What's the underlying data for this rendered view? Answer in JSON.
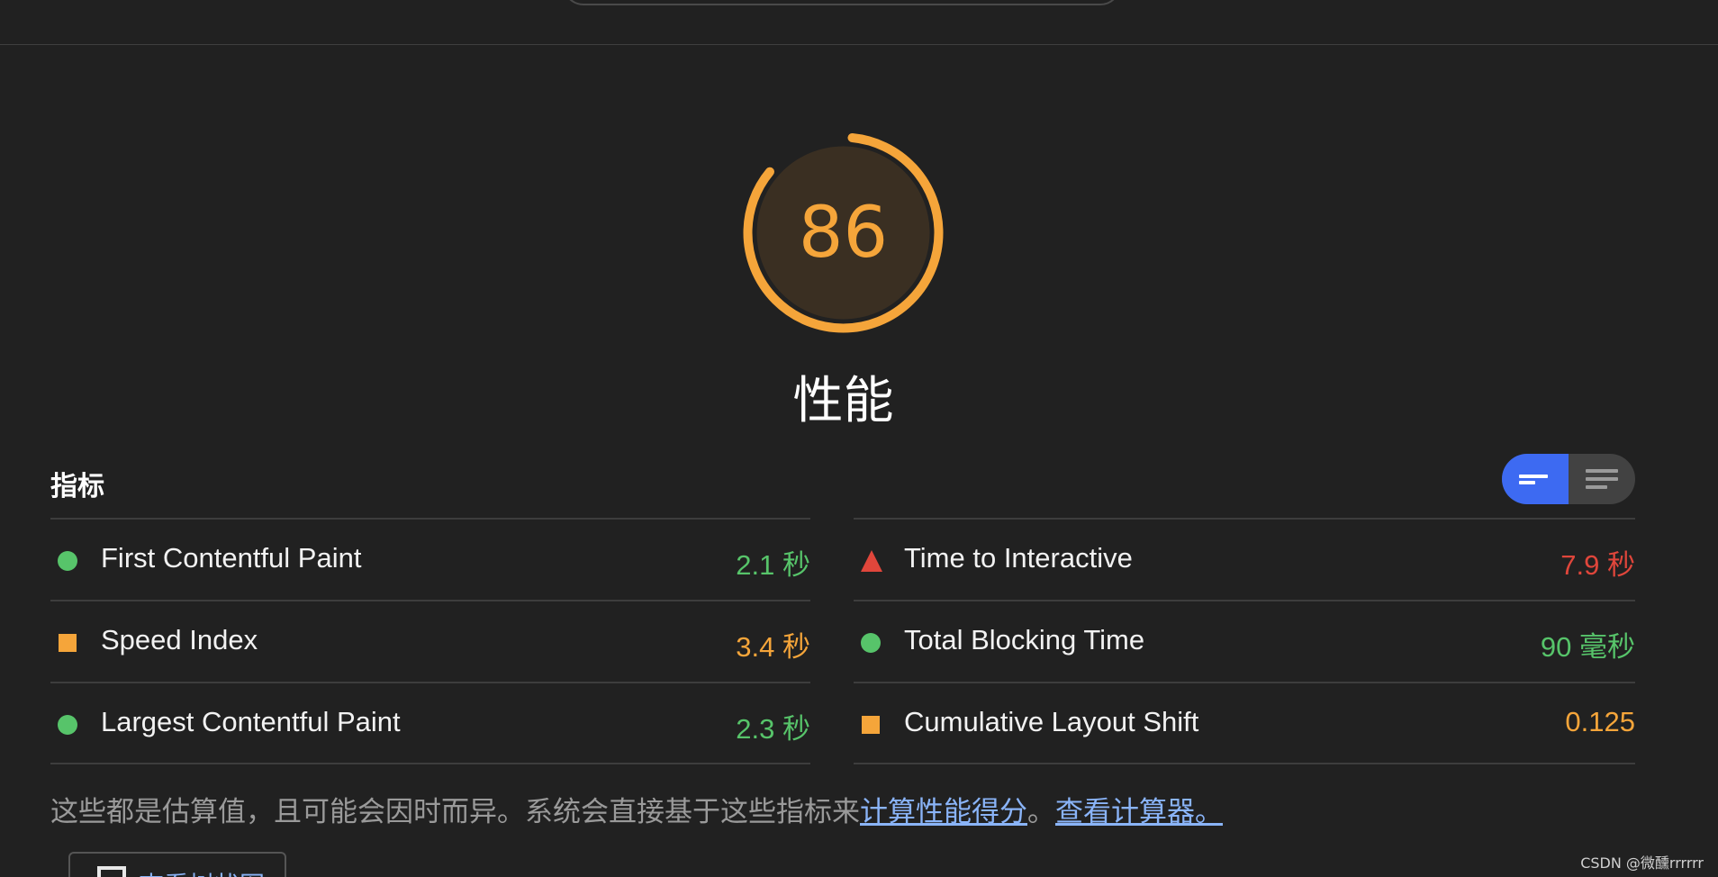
{
  "gauge": {
    "score": "86",
    "fraction": 0.86,
    "title": "性能",
    "color": "#f5a53a"
  },
  "metrics": {
    "header": "指标",
    "left": [
      {
        "label": "First Contentful Paint",
        "value": "2.1 秒",
        "status": "good"
      },
      {
        "label": "Speed Index",
        "value": "3.4 秒",
        "status": "average"
      },
      {
        "label": "Largest Contentful Paint",
        "value": "2.3 秒",
        "status": "good"
      }
    ],
    "right": [
      {
        "label": "Time to Interactive",
        "value": "7.9 秒",
        "status": "poor"
      },
      {
        "label": "Total Blocking Time",
        "value": "90 毫秒",
        "status": "good"
      },
      {
        "label": "Cumulative Layout Shift",
        "value": "0.125",
        "status": "average"
      }
    ]
  },
  "note": {
    "prefix": "这些都是估算值，且可能会因时而异。系统会直接基于这些指标来",
    "link1": "计算性能得分",
    "middle": "。",
    "link2": "查看计算器。"
  },
  "treemap_button": {
    "label": "查看树状图"
  },
  "watermark": "CSDN @微醺rrrrrr",
  "colors": {
    "good": "#57c46a",
    "average": "#f5a53a",
    "poor": "#e0463b",
    "toggle_active": "#3d6af2"
  },
  "icons": {
    "good": "circle",
    "average": "square",
    "poor": "triangle",
    "toggle_compact": "lines-short-icon",
    "toggle_expanded": "lines-long-icon",
    "treemap": "treemap-icon"
  }
}
